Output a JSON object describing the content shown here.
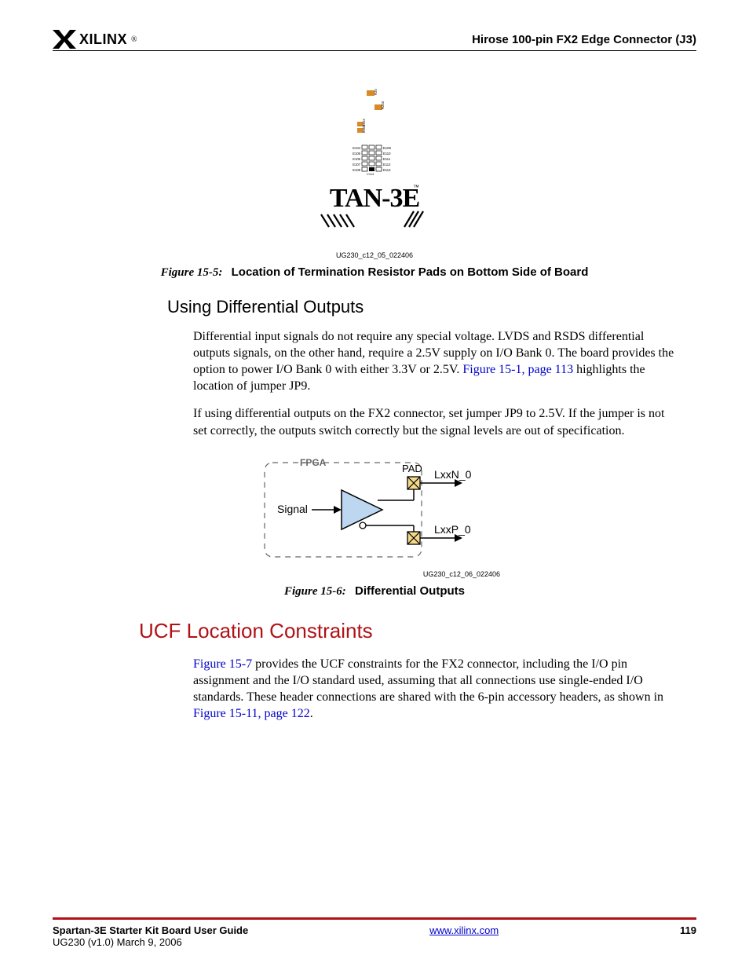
{
  "header": {
    "brand": "XILINX",
    "section_title": "Hirose 100-pin FX2 Edge Connector (J3)"
  },
  "figure5": {
    "image_id": "UG230_c12_05_022406",
    "number": "Figure 15-5:",
    "title": "Location of Termination Resistor Pads on Bottom Side of Board",
    "board_text": "TAN-3E",
    "tm": "™"
  },
  "subhead1": "Using Differential Outputs",
  "para1_a": "Differential input signals do not require any special voltage. LVDS and RSDS differential outputs signals, on the other hand, require a 2.5V supply on I/O Bank 0. The board provides the option to power I/O Bank 0 with either 3.3V or 2.5V. ",
  "para1_link": "Figure 15-1, page 113",
  "para1_b": " highlights the location of jumper JP9.",
  "para2": "If using differential outputs on the FX2 connector, set jumper JP9 to 2.5V. If the jumper is not set correctly, the outputs switch correctly but the signal levels are out of specification.",
  "figure6": {
    "image_id": "UG230_c12_06_022406",
    "labels": {
      "fpga": "FPGA",
      "signal": "Signal",
      "pad": "PAD",
      "lxxn": "LxxN_0",
      "lxxp": "LxxP_0"
    },
    "number": "Figure 15-6:",
    "title": "Differential Outputs"
  },
  "section2": "UCF Location Constraints",
  "para3_link1": "Figure 15-7",
  "para3_a": " provides the UCF constraints for the FX2 connector, including the I/O pin assignment and the I/O standard used, assuming that all connections use single-ended I/O standards. These header connections are shared with the 6-pin accessory headers, as shown in ",
  "para3_link2": "Figure 15-11, page 122",
  "para3_b": ".",
  "footer": {
    "doc_title": "Spartan-3E Starter Kit Board User Guide",
    "doc_version": "UG230 (v1.0) March 9, 2006",
    "url": "www.xilinx.com",
    "page": "119"
  }
}
